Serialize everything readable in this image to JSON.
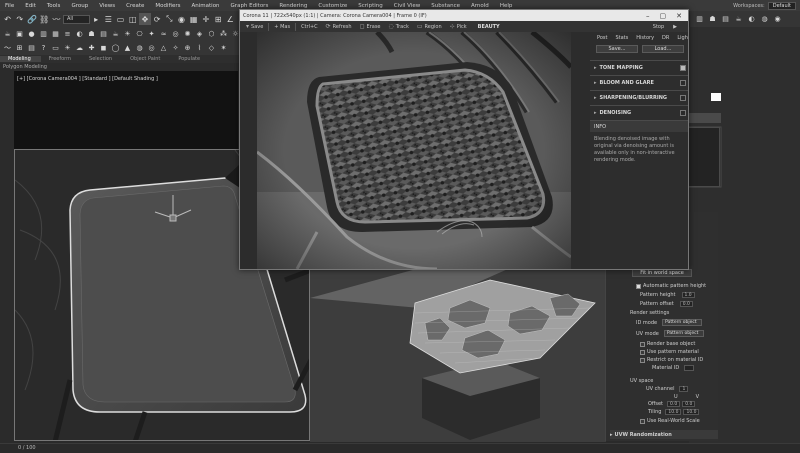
{
  "menubar": {
    "items": [
      "File",
      "Edit",
      "Tools",
      "Group",
      "Views",
      "Create",
      "Modifiers",
      "Animation",
      "Graph Editors",
      "Rendering",
      "Customize",
      "Scripting",
      "Civil View",
      "Substance",
      "Arnold",
      "Help"
    ],
    "workspaces_label": "Workspaces:",
    "workspace_value": "Default"
  },
  "toolbar": {
    "selection_filter": "All"
  },
  "ribbon": {
    "tabs": [
      "Modeling",
      "Freeform",
      "Selection",
      "Object Paint",
      "Populate"
    ],
    "sub_label": "Polygon Modeling"
  },
  "viewport_tl": {
    "label": "[+] [Corona Camera004 ] [Standard ] [Default Shading ]"
  },
  "corona": {
    "title": "Corona 11 | 722x540px (1:1) | Camera: Corona Camera004 | Frame 0 (IF)",
    "toolbar": {
      "save": "Save",
      "mas": "+ Mas",
      "ctrlc": "Ctrl+C",
      "refresh": "Refresh",
      "erase": "Erase",
      "track": "Track",
      "region": "Region",
      "pick": "Pick",
      "channel": "BEAUTY",
      "stop": "Stop"
    },
    "panel": {
      "tabs": [
        "Post",
        "Stats",
        "History",
        "DR",
        "LightMix"
      ],
      "save_btn": "Save...",
      "load_btn": "Load...",
      "sections": [
        "TONE MAPPING",
        "BLOOM AND GLARE",
        "SHARPENING/BLURRING",
        "DENOISING"
      ],
      "info_header": "INFO",
      "info_text": "Blending denoised image with original via denoising amount is available only in non-interactive rendering mode."
    }
  },
  "modpanel": {
    "fit_btn": "Fit in world space",
    "auto_height": "Automatic pattern height",
    "pattern_height": "Pattern height",
    "pattern_height_val": "1.0",
    "pattern_offset": "Pattern offset",
    "pattern_offset_val": "0.0",
    "render_settings": "Render settings",
    "id_mode": "ID mode",
    "id_mode_val": "Pattern object",
    "uv_mode": "UV mode",
    "uv_mode_val": "Pattern object",
    "render_base": "Render base object",
    "use_pattern_mat": "Use pattern material",
    "restrict_id": "Restrict on material ID",
    "material_id": "Material ID",
    "uv_space": "UV space",
    "uv_channel": "UV channel",
    "uv_channel_val": "1",
    "u_label": "U",
    "v_label": "V",
    "offset_label": "Offset",
    "offset_u": "0.0",
    "offset_v": "0.0",
    "tiling_label": "Tiling",
    "tiling_u": "10.0",
    "tiling_v": "10.0",
    "real_world": "Use Real-World Scale",
    "uvw_random": "UVW Randomization"
  },
  "status": {
    "frame": "0 / 100"
  },
  "colors": {
    "bg": "#2a2a2a",
    "title_bar": "#e8e8e8"
  }
}
